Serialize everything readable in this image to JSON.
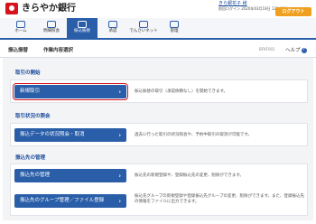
{
  "header": {
    "bank_name": "きらやか銀行",
    "user_name": "きら銀花子 様",
    "last_login": "前回ログイン 2020年03月18日 12時06分",
    "logout_label": "ログアウト"
  },
  "nav": {
    "items": [
      {
        "label": "ホーム",
        "icon": "home-icon"
      },
      {
        "label": "明細照会",
        "icon": "statement-icon"
      },
      {
        "label": "振込振替",
        "icon": "transfer-icon"
      },
      {
        "label": "承認",
        "icon": "approval-icon"
      },
      {
        "label": "でんさいネット",
        "icon": "densai-icon"
      },
      {
        "label": "管理",
        "icon": "admin-icon"
      }
    ],
    "active_index": 2
  },
  "breadcrumb": {
    "section": "振込振替",
    "page": "作業内容選択",
    "screen_id": "BFKF001",
    "help_label": "ヘルプ"
  },
  "sections": [
    {
      "title": "取引の開始",
      "rows": [
        {
          "button": "新規取引",
          "desc": "振込振替の取引（承認依頼なし）を開始できます。"
        }
      ]
    },
    {
      "title": "取引状況の照会",
      "rows": [
        {
          "button": "振込データの状況照会・取消",
          "desc": "過去に行った取引の状況照会や、予約中取引の取消が可能です。"
        }
      ]
    },
    {
      "title": "振込先の管理",
      "rows": [
        {
          "button": "振込先の管理",
          "desc": "振込先の新規登録や、登録振込先の変更、削除ができます。"
        },
        {
          "button": "振込先のグループ管理／ファイル登録",
          "desc": "振込先グループの新規登録や登録振込先グループの変更、削除ができます。また、登録振込先の情報をファイルに出力できます。"
        }
      ]
    }
  ],
  "colors": {
    "brand_red": "#d7131b",
    "primary_blue": "#2a5ea8",
    "logout_orange": "#f0a020"
  }
}
